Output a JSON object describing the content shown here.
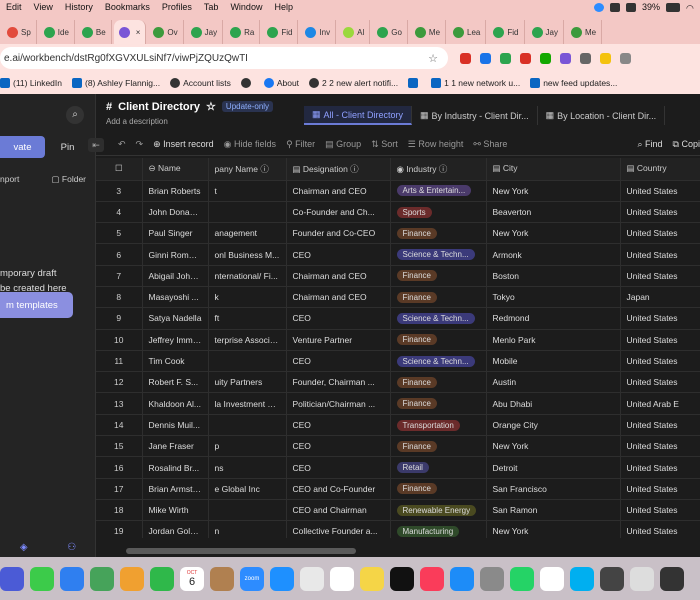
{
  "menubar": {
    "items": [
      "Edit",
      "View",
      "History",
      "Bookmarks",
      "Profiles",
      "Tab",
      "Window",
      "Help"
    ],
    "battery": "39%"
  },
  "tabs": [
    {
      "label": "Sp",
      "color": "#e24b3c"
    },
    {
      "label": "Ide",
      "color": "#2da44e"
    },
    {
      "label": "Be",
      "color": "#2da44e"
    },
    {
      "label": "",
      "color": "#7a55d6",
      "active": true
    },
    {
      "label": "Ov",
      "color": "#3c9a3c"
    },
    {
      "label": "Jay",
      "color": "#2da44e"
    },
    {
      "label": "Ra",
      "color": "#2da44e"
    },
    {
      "label": "Fid",
      "color": "#2da44e"
    },
    {
      "label": "Inv",
      "color": "#1e88e5"
    },
    {
      "label": "Al",
      "color": "#9bd83c"
    },
    {
      "label": "Go",
      "color": "#2da44e"
    },
    {
      "label": "Me",
      "color": "#3c9a3c"
    },
    {
      "label": "Lea",
      "color": "#3c9a3c"
    },
    {
      "label": "Fid",
      "color": "#2da44e"
    },
    {
      "label": "Jay",
      "color": "#2da44e"
    },
    {
      "label": "Me",
      "color": "#3c9a3c"
    }
  ],
  "address": {
    "url": "e.ai/workbench/dstRg0fXGVXULsiNf7/viwPjZQUzQwTI"
  },
  "bookmarks": [
    {
      "label": "(11) LinkedIn",
      "icon": "linkedin"
    },
    {
      "label": "(8) Ashley Flannig...",
      "icon": "linkedin"
    },
    {
      "label": "Account lists",
      "icon": "globe"
    },
    {
      "label": "",
      "icon": "globe"
    },
    {
      "label": "About",
      "icon": "meta"
    },
    {
      "label": "2 2 new alert notifi...",
      "icon": "globe"
    },
    {
      "label": "",
      "icon": "linkedin"
    },
    {
      "label": "1 1 new network u...",
      "icon": "linkedin"
    },
    {
      "label": "new feed updates...",
      "icon": "linkedin"
    }
  ],
  "sidebar": {
    "tab_private": "vate",
    "tab_pin": "Pin",
    "import": "nport",
    "folder": "Folder",
    "message_line1": "mporary draft",
    "message_line2": "be created here",
    "learn_more": "more",
    "templates_button": "m templates"
  },
  "header": {
    "title": "Client Directory",
    "badge": "Update-only",
    "description": "Add a description",
    "views": [
      "All - Client Directory",
      "By Industry - Client Dir...",
      "By Location - Client Dir..."
    ]
  },
  "toolbar": {
    "insert": "Insert record",
    "hide": "Hide fields",
    "filter": "Filter",
    "group": "Group",
    "sort": "Sort",
    "row_height": "Row height",
    "share": "Share",
    "find": "Find",
    "copy": "Copi"
  },
  "columns": [
    "Name",
    "pany Name",
    "Designation",
    "Industry",
    "City",
    "Country"
  ],
  "rows": [
    {
      "n": "3",
      "name": "Brian Roberts",
      "company": "t",
      "designation": "Chairman and CEO",
      "industry": "Arts & Entertain...",
      "city": "New York",
      "country": "United States"
    },
    {
      "n": "4",
      "name": "John Donahoe",
      "company": "",
      "designation": "Co-Founder and Ch...",
      "industry": "Sports",
      "city": "Beaverton",
      "country": "United States"
    },
    {
      "n": "5",
      "name": "Paul Singer",
      "company": "anagement",
      "designation": "Founder and Co-CEO",
      "industry": "Finance",
      "city": "New York",
      "country": "United States"
    },
    {
      "n": "6",
      "name": "Ginni Rometty",
      "company": "onl Business M...",
      "designation": "CEO",
      "industry": "Science & Techn...",
      "city": "Armonk",
      "country": "United States"
    },
    {
      "n": "7",
      "name": "Abigail John...",
      "company": "nternational/ Fi...",
      "designation": "Chairman and CEO",
      "industry": "Finance",
      "city": "Boston",
      "country": "United States"
    },
    {
      "n": "8",
      "name": "Masayoshi ...",
      "company": "k",
      "designation": "Chairman and CEO",
      "industry": "Finance",
      "city": "Tokyo",
      "country": "Japan"
    },
    {
      "n": "9",
      "name": "Satya Nadella",
      "company": "ft",
      "designation": "CEO",
      "industry": "Science & Techn...",
      "city": "Redmond",
      "country": "United States"
    },
    {
      "n": "10",
      "name": "Jeffrey Immelt",
      "company": "terprise Associa...",
      "designation": "Venture Partner",
      "industry": "Finance",
      "city": "Menlo Park",
      "country": "United States"
    },
    {
      "n": "11",
      "name": "Tim Cook",
      "company": "",
      "designation": "CEO",
      "industry": "Science & Techn...",
      "city": "Mobile",
      "country": "United States"
    },
    {
      "n": "12",
      "name": "Robert F. S...",
      "company": "uity Partners",
      "designation": "Founder, Chairman ...",
      "industry": "Finance",
      "city": "Austin",
      "country": "United States"
    },
    {
      "n": "13",
      "name": "Khaldoon Al...",
      "company": "la Investment C...",
      "designation": "Politician/Chairman ...",
      "industry": "Finance",
      "city": "Abu Dhabi",
      "country": "United Arab E"
    },
    {
      "n": "14",
      "name": "Dennis Muil...",
      "company": "",
      "designation": "CEO",
      "industry": "Transportation",
      "city": "Orange City",
      "country": "United States"
    },
    {
      "n": "15",
      "name": "Jane Fraser",
      "company": "p",
      "designation": "CEO",
      "industry": "Finance",
      "city": "New York",
      "country": "United States"
    },
    {
      "n": "16",
      "name": "Rosalind Br...",
      "company": "ns",
      "designation": "CEO",
      "industry": "Retail",
      "city": "Detroit",
      "country": "United States"
    },
    {
      "n": "17",
      "name": "Brian Armstr...",
      "company": "e Global Inc",
      "designation": "CEO and Co-Founder",
      "industry": "Finance",
      "city": "San Francisco",
      "country": "United States"
    },
    {
      "n": "18",
      "name": "Mike Wirth",
      "company": "",
      "designation": "CEO and Chairman",
      "industry": "Renewable Energy",
      "city": "San Ramon",
      "country": "United States"
    },
    {
      "n": "19",
      "name": "Jordan Gold...",
      "company": "n",
      "designation": "Collective Founder a...",
      "industry": "Manufacturing",
      "city": "New York",
      "country": "United States"
    }
  ],
  "industry_colors": {
    "Arts & Entertain...": "#4a3a6a",
    "Sports": "#6b2b2b",
    "Finance": "#5a3a26",
    "Science & Techn...": "#3b3a7a",
    "Transportation": "#6b2b2b",
    "Retail": "#3b3a6a",
    "Renewable Energy": "#4a4a20",
    "Manufacturing": "#2f4a2a"
  },
  "dock": {
    "calendar_month": "OCT",
    "calendar_day": "6",
    "zoom": "zoom"
  }
}
